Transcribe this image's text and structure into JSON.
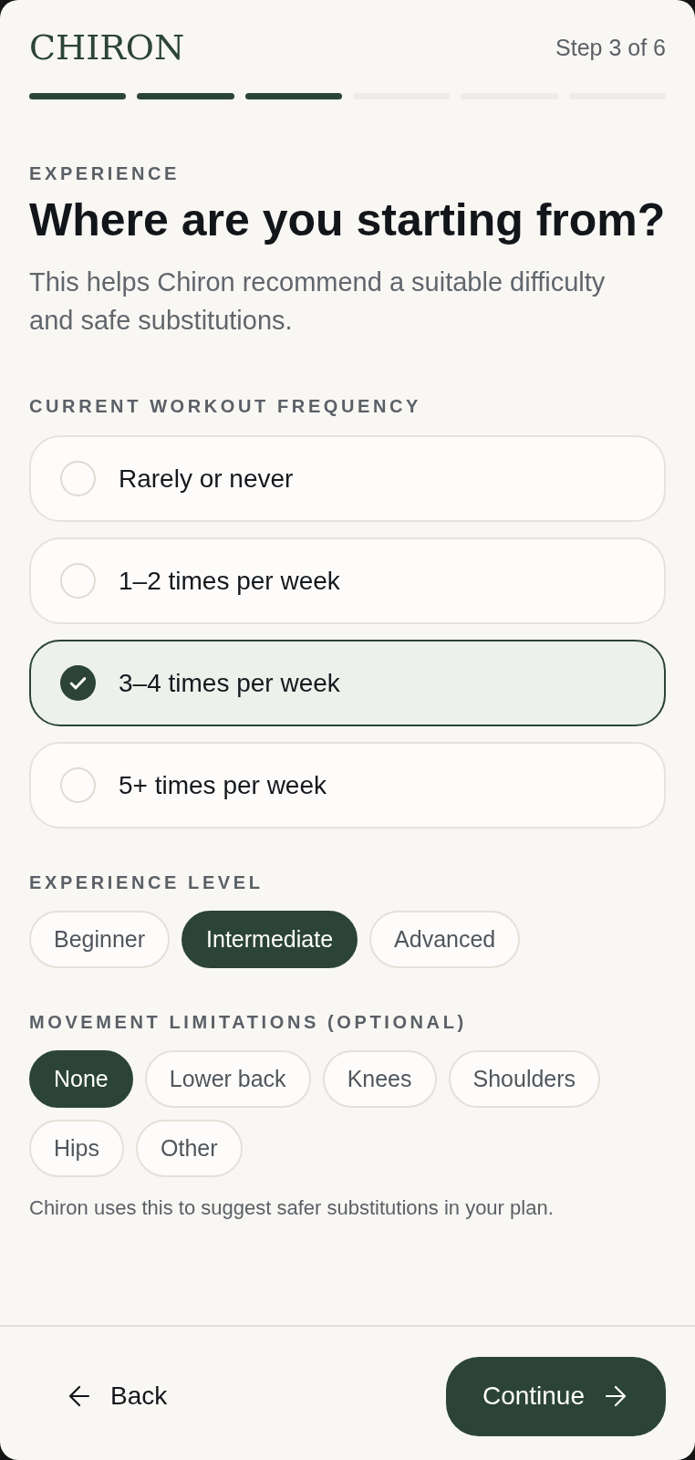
{
  "header": {
    "logo": "CHIRON",
    "step_label": "Step 3 of 6",
    "progress": [
      {
        "completed": true
      },
      {
        "completed": true
      },
      {
        "completed": true
      },
      {
        "completed": false
      },
      {
        "completed": false
      },
      {
        "completed": false
      }
    ]
  },
  "intro": {
    "eyebrow": "EXPERIENCE",
    "title": "Where are you starting from?",
    "description": "This helps Chiron recommend a suitable difficulty and safe substitutions."
  },
  "workout_frequency": {
    "label": "CURRENT WORKOUT FREQUENCY",
    "options": [
      {
        "label": "Rarely or never",
        "selected": false
      },
      {
        "label": "1–2 times per week",
        "selected": false
      },
      {
        "label": "3–4 times per week",
        "selected": true
      },
      {
        "label": "5+ times per week",
        "selected": false
      }
    ]
  },
  "experience_level": {
    "label": "EXPERIENCE LEVEL",
    "options": [
      {
        "label": "Beginner",
        "selected": false
      },
      {
        "label": "Intermediate",
        "selected": true
      },
      {
        "label": "Advanced",
        "selected": false
      }
    ]
  },
  "movement_limitations": {
    "label": "MOVEMENT LIMITATIONS (OPTIONAL)",
    "options": [
      {
        "label": "None",
        "selected": true
      },
      {
        "label": "Lower back",
        "selected": false
      },
      {
        "label": "Knees",
        "selected": false
      },
      {
        "label": "Shoulders",
        "selected": false
      },
      {
        "label": "Hips",
        "selected": false
      },
      {
        "label": "Other",
        "selected": false
      }
    ],
    "hint": "Chiron uses this to suggest safer substitutions in your plan."
  },
  "footer": {
    "back_button": "Back",
    "continue_button": "Continue"
  }
}
